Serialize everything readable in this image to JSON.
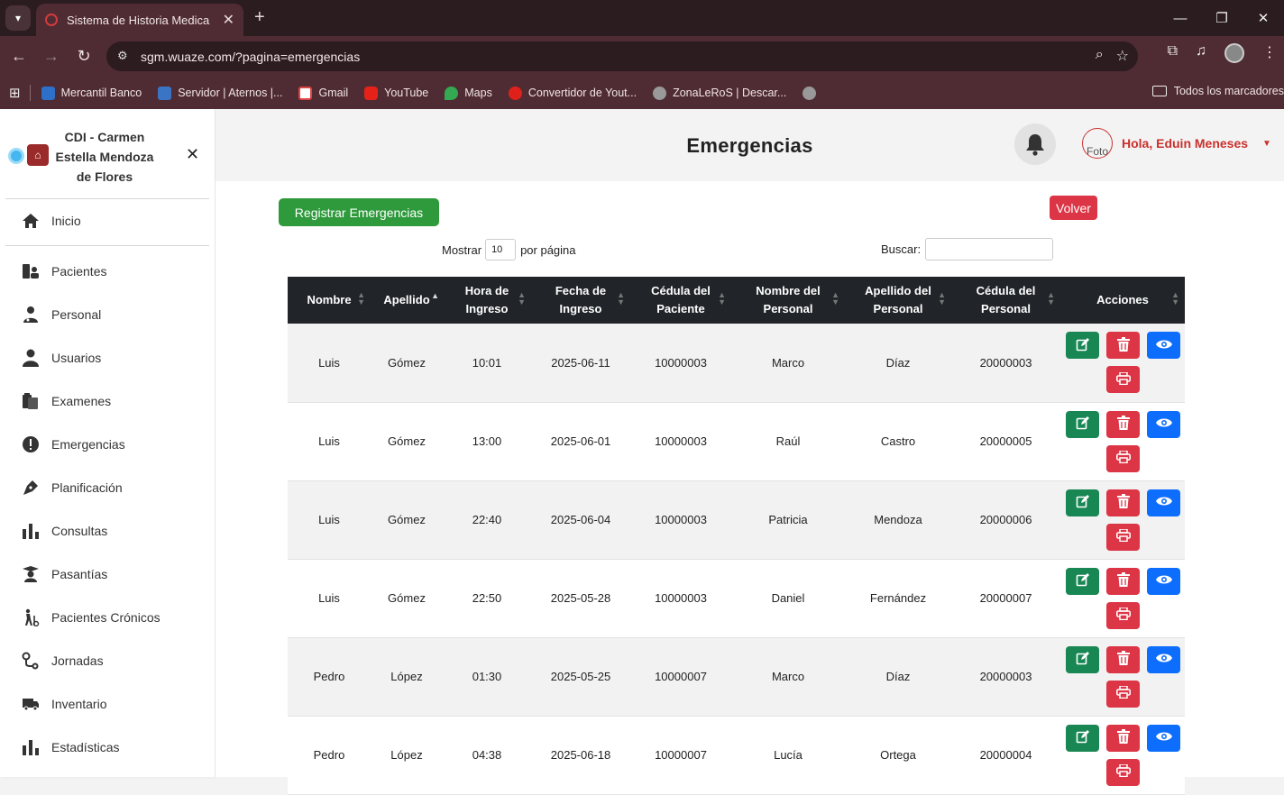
{
  "browser": {
    "tab_title": "Sistema de Historia Medica",
    "url": "sgm.wuaze.com/?pagina=emergencias",
    "bookmarks": [
      "Mercantil Banco",
      "Servidor | Aternos |...",
      "Gmail",
      "YouTube",
      "Maps",
      "Convertidor de Yout...",
      "ZonaLeRoS | Descar..."
    ],
    "all_bookmarks": "Todos los marcadores"
  },
  "sidebar": {
    "brand": "CDI - Carmen Estella Mendoza de Flores",
    "items": [
      "Inicio",
      "Pacientes",
      "Personal",
      "Usuarios",
      "Examenes",
      "Emergencias",
      "Planificación",
      "Consultas",
      "Pasantías",
      "Pacientes Crónicos",
      "Jornadas",
      "Inventario",
      "Estadísticas"
    ]
  },
  "header": {
    "title": "Emergencias",
    "user_photo_alt": "Foto",
    "greeting": "Hola, Eduin Meneses"
  },
  "controls": {
    "register_button": "Registrar Emergencias",
    "back_button": "Volver",
    "show_label": "Mostrar",
    "page_size": "10",
    "per_page_label": "por página",
    "search_label": "Buscar:",
    "search_value": ""
  },
  "table": {
    "columns": [
      "Nombre",
      "Apellido",
      "Hora de Ingreso",
      "Fecha de Ingreso",
      "Cédula del Paciente",
      "Nombre del Personal",
      "Apellido del Personal",
      "Cédula del Personal",
      "Acciones"
    ],
    "rows": [
      [
        "Luis",
        "Gómez",
        "10:01",
        "2025-06-11",
        "10000003",
        "Marco",
        "Díaz",
        "20000003"
      ],
      [
        "Luis",
        "Gómez",
        "13:00",
        "2025-06-01",
        "10000003",
        "Raúl",
        "Castro",
        "20000005"
      ],
      [
        "Luis",
        "Gómez",
        "22:40",
        "2025-06-04",
        "10000003",
        "Patricia",
        "Mendoza",
        "20000006"
      ],
      [
        "Luis",
        "Gómez",
        "22:50",
        "2025-05-28",
        "10000003",
        "Daniel",
        "Fernández",
        "20000007"
      ],
      [
        "Pedro",
        "López",
        "01:30",
        "2025-05-25",
        "10000007",
        "Marco",
        "Díaz",
        "20000003"
      ],
      [
        "Pedro",
        "López",
        "04:38",
        "2025-06-18",
        "10000007",
        "Lucía",
        "Ortega",
        "20000004"
      ]
    ]
  }
}
